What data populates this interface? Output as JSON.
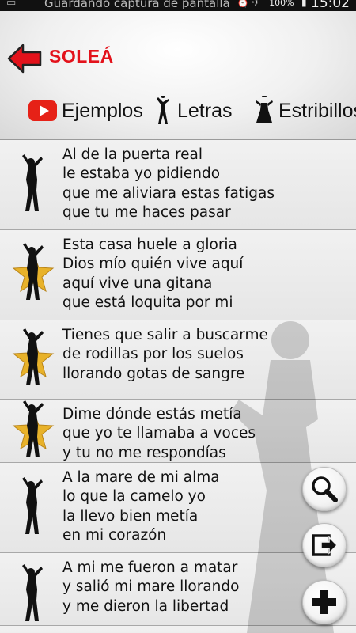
{
  "status_bar": {
    "notification_text": "Guardando captura de pantalla",
    "battery": "100%",
    "time": "15:02"
  },
  "header": {
    "title": "SOLEÁ",
    "tabs": [
      {
        "label": "Ejemplos",
        "icon": "youtube-icon"
      },
      {
        "label": "Letras",
        "icon": "flamenco-dancer-icon"
      },
      {
        "label": "Estribillos",
        "icon": "flamenco-dancer-dress-icon"
      }
    ]
  },
  "colors": {
    "title_red": "#e3121b",
    "youtube_red": "#e62117",
    "star_gold": "#e8b22a"
  },
  "verses": [
    {
      "text": "Al de la puerta real\nle estaba yo pidiendo\nque me aliviara estas fatigas\nque tu me haces pasar",
      "favorite": false
    },
    {
      "text": "Esta casa huele a gloria\nDios mío quién vive aquí\naquí vive una gitana\nque está loquita por mi",
      "favorite": true
    },
    {
      "text": "Tienes que salir a buscarme\nde rodillas por los suelos\nllorando gotas de sangre",
      "favorite": true
    },
    {
      "text": "Dime dónde estás metía\nque yo te llamaba a voces\ny tu no me respondías",
      "favorite": true
    },
    {
      "text": "A la mare de mi alma\nlo que la camelo yo\nla llevo bien metía\nen mi corazón",
      "favorite": false
    },
    {
      "text": "A mi me fueron a matar\ny salió mi mare llorando\ny me dieron la libertad",
      "favorite": false
    }
  ],
  "actions": {
    "search": "search-icon",
    "share": "share-icon",
    "add": "plus-icon"
  }
}
